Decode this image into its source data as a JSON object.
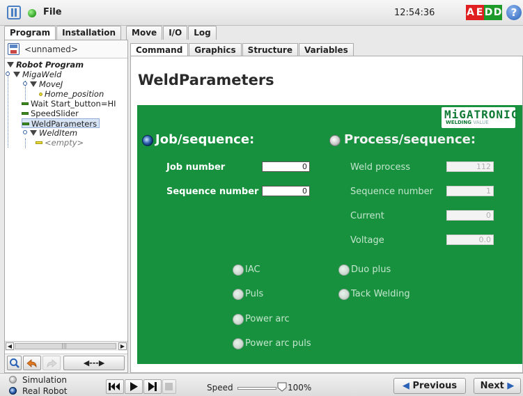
{
  "header": {
    "menu_label": "File",
    "time": "12:54:36",
    "aedd": [
      {
        "letter": "A",
        "color": "#e02020"
      },
      {
        "letter": "E",
        "color": "#e02020"
      },
      {
        "letter": "D",
        "color": "#1e9a2a"
      },
      {
        "letter": "D",
        "color": "#1e9a2a"
      }
    ],
    "help_label": "?",
    "icons": {
      "logo": "ur-logo-icon",
      "status": "robot-status-icon",
      "help": "help-icon"
    }
  },
  "main_tabs": {
    "left": [
      "Program",
      "Installation"
    ],
    "right": [
      "Move",
      "I/O",
      "Log"
    ],
    "active": "Program"
  },
  "program": {
    "name": "<unnamed>",
    "tree": [
      {
        "label": "Robot Program",
        "style": "root"
      },
      {
        "label": "MigaWeld",
        "style": "folder"
      },
      {
        "label": "MoveJ",
        "style": "folder"
      },
      {
        "label": "Home_position",
        "style": "waypoint"
      },
      {
        "label": "Wait Start_button=HI",
        "style": "cmd"
      },
      {
        "label": "SpeedSlider",
        "style": "cmd"
      },
      {
        "label": "WeldParameters",
        "style": "cmd",
        "selected": true
      },
      {
        "label": "WeldItem",
        "style": "folder"
      },
      {
        "label": "<empty>",
        "style": "empty"
      }
    ],
    "scroll_glyphs": {
      "left": "◀",
      "right": "▶",
      "grip": "|||"
    },
    "tools": {
      "search_icon": "search-icon",
      "undo_icon": "undo-icon",
      "redo_icon": "redo-icon",
      "move_label": "◀---▶"
    }
  },
  "sub_tabs": {
    "items": [
      "Command",
      "Graphics",
      "Structure",
      "Variables"
    ],
    "active": "Command"
  },
  "page": {
    "title": "WeldParameters",
    "brand": {
      "name": "MiGATRONIC",
      "tagline_a": "WELDING",
      "tagline_b": "VALUE"
    },
    "job": {
      "heading": "Job/sequence:",
      "selected": true,
      "job_number_label": "Job number",
      "job_number": "0",
      "sequence_number_label": "Sequence number",
      "sequence_number": "0"
    },
    "process": {
      "heading": "Process/sequence:",
      "selected": false,
      "weld_process_label": "Weld process",
      "weld_process": "112",
      "sequence_number_label": "Sequence number",
      "sequence_number": "1",
      "current_label": "Current",
      "current": "0",
      "voltage_label": "Voltage",
      "voltage": "0.0"
    },
    "options_left": [
      "IAC",
      "Puls",
      "Power arc",
      "Power arc puls"
    ],
    "options_right": [
      "Duo plus",
      "Tack Welding"
    ],
    "panel_color": "#18913f"
  },
  "footer": {
    "modes": [
      "Simulation",
      "Real Robot"
    ],
    "speed_label": "Speed",
    "speed_value": "100%",
    "speed_fraction": 1.0,
    "previous_label": "Previous",
    "next_label": "Next",
    "icons": [
      "skip-back-icon",
      "play-icon",
      "step-forward-icon",
      "stop-icon"
    ]
  }
}
